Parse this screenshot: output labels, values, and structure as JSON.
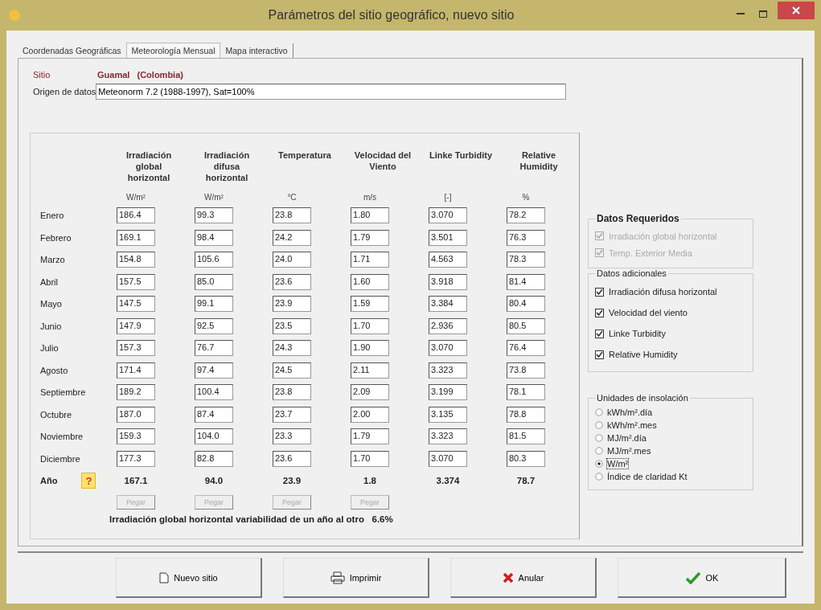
{
  "window": {
    "title": "Parámetros del sitio geográfico, nuevo sitio"
  },
  "tabs": [
    {
      "label": "Coordenadas Geográficas",
      "selected": false
    },
    {
      "label": "Meteorología Mensual",
      "selected": true
    },
    {
      "label": "Mapa interactivo",
      "selected": false
    }
  ],
  "site": {
    "label": "Sitio",
    "value": "Guamal   (Colombia)"
  },
  "source": {
    "label": "Origen de datos",
    "value": "Meteonorm 7.2 (1988-1997), Sat=100%"
  },
  "columns": [
    {
      "header": "Irradiación global horizontal",
      "unit": "W/m²",
      "paste": {
        "label": "Pegar",
        "disabled": true
      }
    },
    {
      "header": "Irradiación difusa horizontal",
      "unit": "W/m²",
      "paste": {
        "label": "Pegar",
        "disabled": true
      }
    },
    {
      "header": "Temperatura",
      "unit": "°C",
      "paste": {
        "label": "Pegar",
        "disabled": true
      }
    },
    {
      "header": "Velocidad del Viento",
      "unit": "m/s",
      "paste": {
        "label": "Pegar",
        "disabled": true
      }
    },
    {
      "header": "Linke Turbidity",
      "unit": "[-]"
    },
    {
      "header": "Relative Humidity",
      "unit": "%"
    }
  ],
  "months": [
    {
      "name": "Enero",
      "values": [
        "186.4",
        "99.3",
        "23.8",
        "1.80",
        "3.070",
        "78.2"
      ]
    },
    {
      "name": "Febrero",
      "values": [
        "169.1",
        "98.4",
        "24.2",
        "1.79",
        "3.501",
        "76.3"
      ]
    },
    {
      "name": "Marzo",
      "values": [
        "154.8",
        "105.6",
        "24.0",
        "1.71",
        "4.563",
        "78.3"
      ]
    },
    {
      "name": "Abril",
      "values": [
        "157.5",
        "85.0",
        "23.6",
        "1.60",
        "3.918",
        "81.4"
      ]
    },
    {
      "name": "Mayo",
      "values": [
        "147.5",
        "99.1",
        "23.9",
        "1.59",
        "3.384",
        "80.4"
      ]
    },
    {
      "name": "Junio",
      "values": [
        "147.9",
        "92.5",
        "23.5",
        "1.70",
        "2.936",
        "80.5"
      ]
    },
    {
      "name": "Julio",
      "values": [
        "157.3",
        "76.7",
        "24.3",
        "1.90",
        "3.070",
        "76.4"
      ]
    },
    {
      "name": "Agosto",
      "values": [
        "171.4",
        "97.4",
        "24.5",
        "2.11",
        "3.323",
        "73.8"
      ]
    },
    {
      "name": "Septiembre",
      "values": [
        "189.2",
        "100.4",
        "23.8",
        "2.09",
        "3.199",
        "78.1"
      ]
    },
    {
      "name": "Octubre",
      "values": [
        "187.0",
        "87.4",
        "23.7",
        "2.00",
        "3.135",
        "78.8"
      ]
    },
    {
      "name": "Noviembre",
      "values": [
        "159.3",
        "104.0",
        "23.3",
        "1.79",
        "3.323",
        "81.5"
      ]
    },
    {
      "name": "Diciembre",
      "values": [
        "177.3",
        "82.8",
        "23.6",
        "1.70",
        "3.070",
        "80.3"
      ]
    }
  ],
  "year": {
    "label": "Año",
    "help": "?",
    "values": [
      "167.1",
      "94.0",
      "23.9",
      "1.8",
      "3.374",
      "78.7"
    ]
  },
  "variability": "Irradiación global horizontal variabilidad de un año al otro   6.6%",
  "required": {
    "title": "Datos Requeridos",
    "items": [
      {
        "label": "Irradiación global horizontal",
        "checked": true,
        "disabled": true
      },
      {
        "label": "Temp. Exterior Media",
        "checked": true,
        "disabled": true
      }
    ]
  },
  "additional": {
    "title": "Datos adicionales",
    "items": [
      {
        "label": "Irradiación difusa horizontal",
        "checked": true,
        "disabled": false
      },
      {
        "label": "Velocidad del viento",
        "checked": true,
        "disabled": false
      },
      {
        "label": "Linke Turbidity",
        "checked": true,
        "disabled": false
      },
      {
        "label": "Relative Humidity",
        "checked": true,
        "disabled": false
      }
    ]
  },
  "units": {
    "title": "Unidades de insolación",
    "options": [
      {
        "label": "kWh/m².día",
        "selected": false
      },
      {
        "label": "kWh/m².mes",
        "selected": false
      },
      {
        "label": "MJ/m².día",
        "selected": false
      },
      {
        "label": "MJ/m².mes",
        "selected": false
      },
      {
        "label": "W/m²",
        "selected": true
      },
      {
        "label": "Índice de claridad Kt",
        "selected": false
      }
    ]
  },
  "buttons": [
    {
      "label": "Nuevo sitio",
      "kind": "new"
    },
    {
      "label": "Imprimir",
      "kind": "print"
    },
    {
      "label": "Anular",
      "kind": "cancel"
    },
    {
      "label": "OK",
      "kind": "ok"
    }
  ]
}
